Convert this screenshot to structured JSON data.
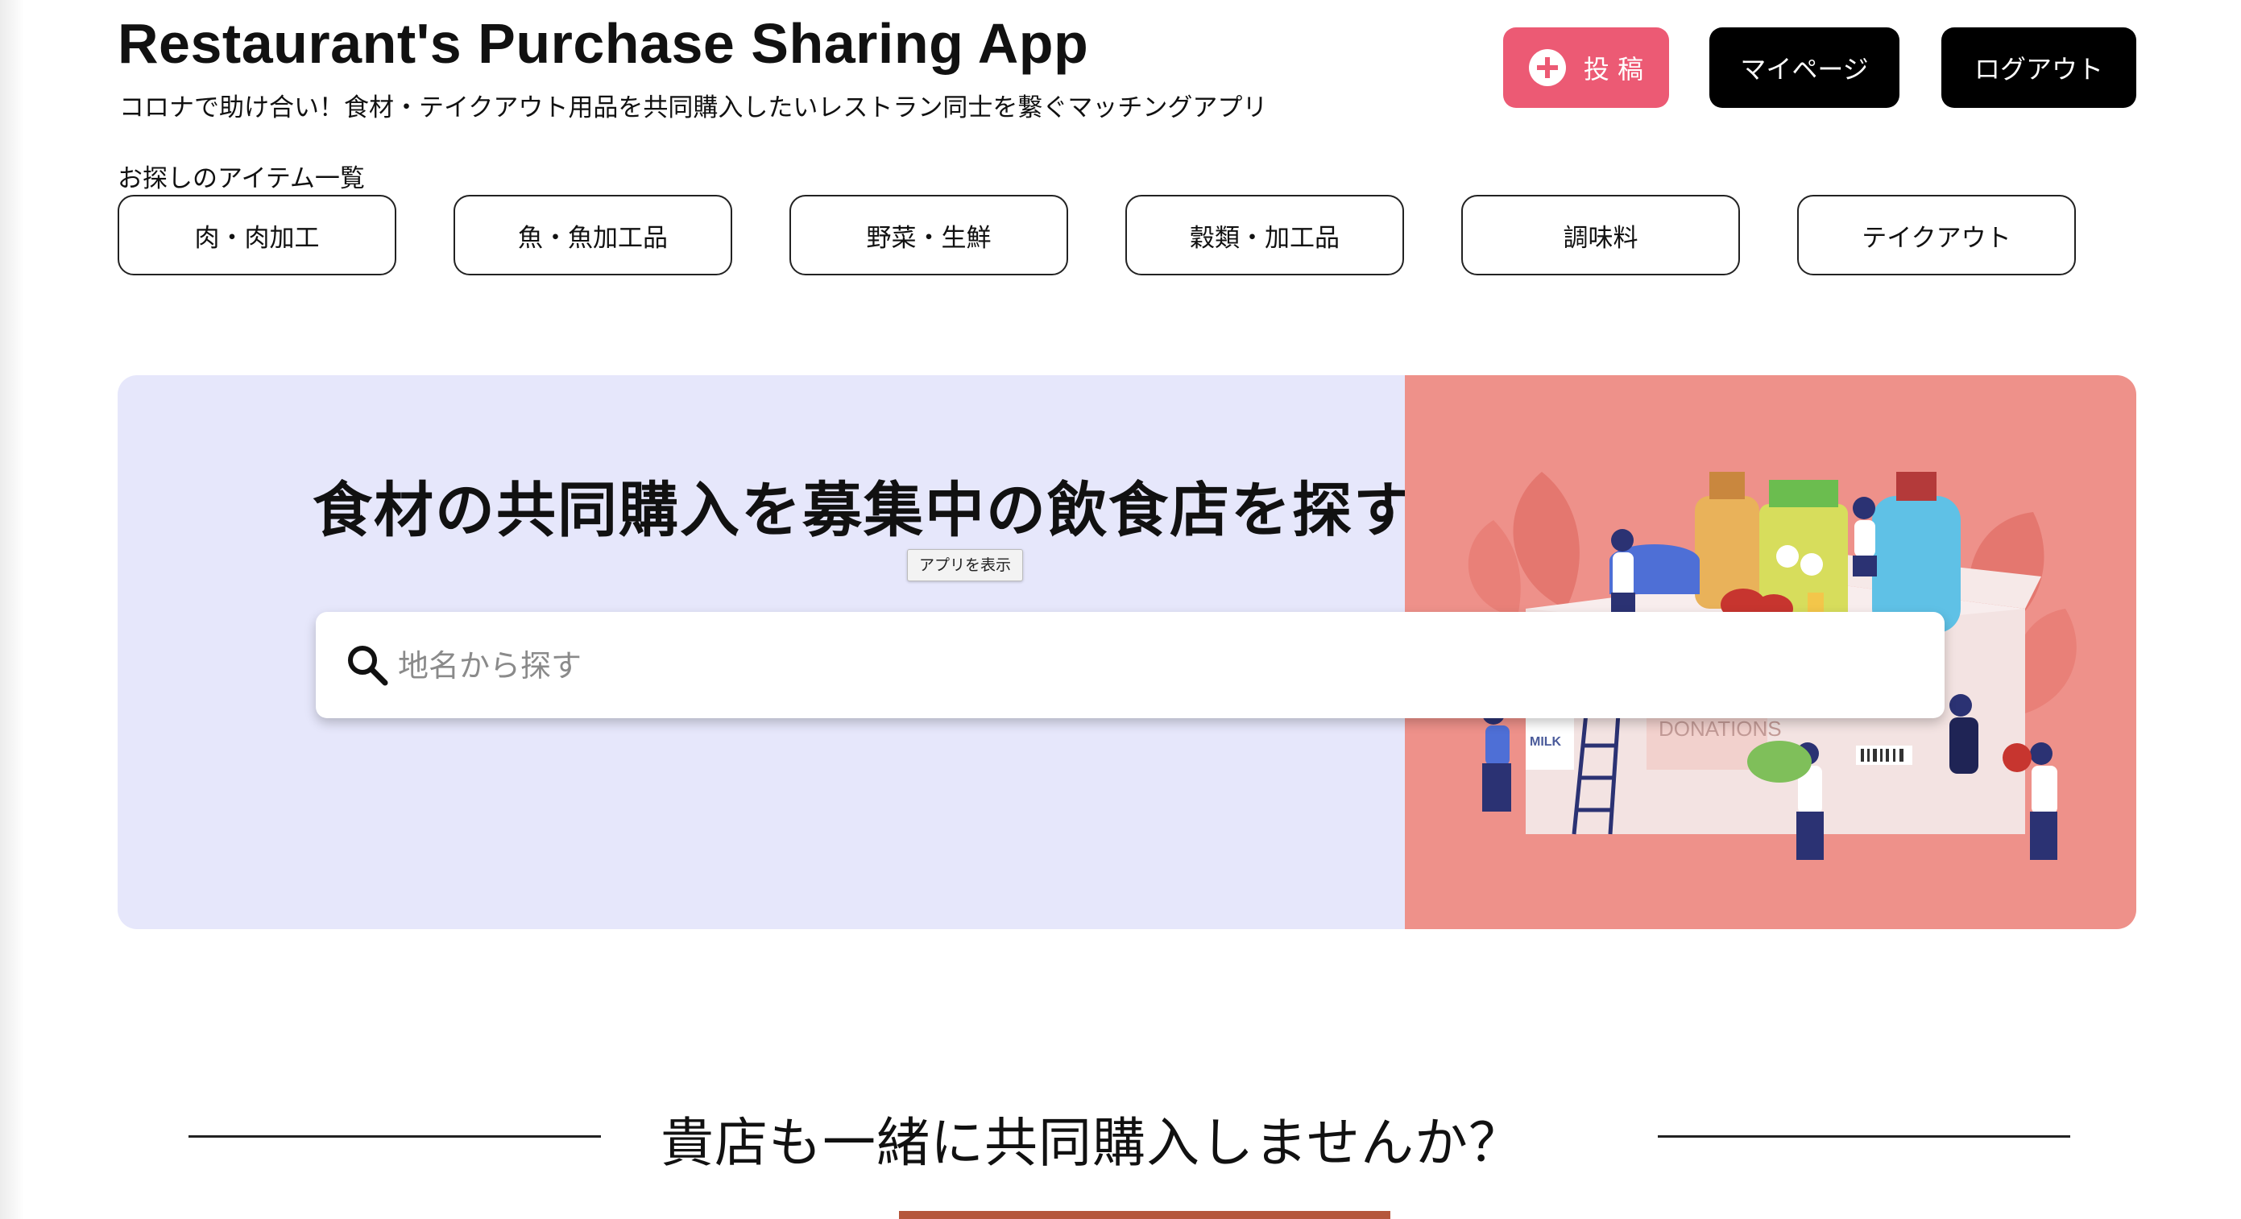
{
  "header": {
    "title": "Restaurant's Purchase Sharing App",
    "subtitle": "コロナで助け合い！食材・テイクアウト用品を共同購入したいレストラン同士を繋ぐマッチングアプリ",
    "post_button": "投 稿",
    "mypage_button": "マイページ",
    "logout_button": "ログアウト"
  },
  "categories": {
    "heading": "お探しのアイテム一覧",
    "items": [
      "肉・肉加工",
      "魚・魚加工品",
      "野菜・生鮮",
      "穀類・加工品",
      "調味料",
      "テイクアウト"
    ]
  },
  "hero": {
    "title": "食材の共同購入を募集中の飲食店を探す",
    "tooltip": "アプリを表示",
    "search_placeholder": "地名から探す",
    "illustration_labels": {
      "milk": "MILK",
      "donations": "DONATIONS"
    }
  },
  "section": {
    "title": "貴店も一緒に共同購入しませんか？"
  },
  "colors": {
    "accent": "#ec5a74",
    "hero_left_bg": "#e6e7fb",
    "hero_right_bg": "#ee918a",
    "black": "#000000"
  },
  "icons": [
    "plus-circle-icon",
    "search-icon"
  ]
}
